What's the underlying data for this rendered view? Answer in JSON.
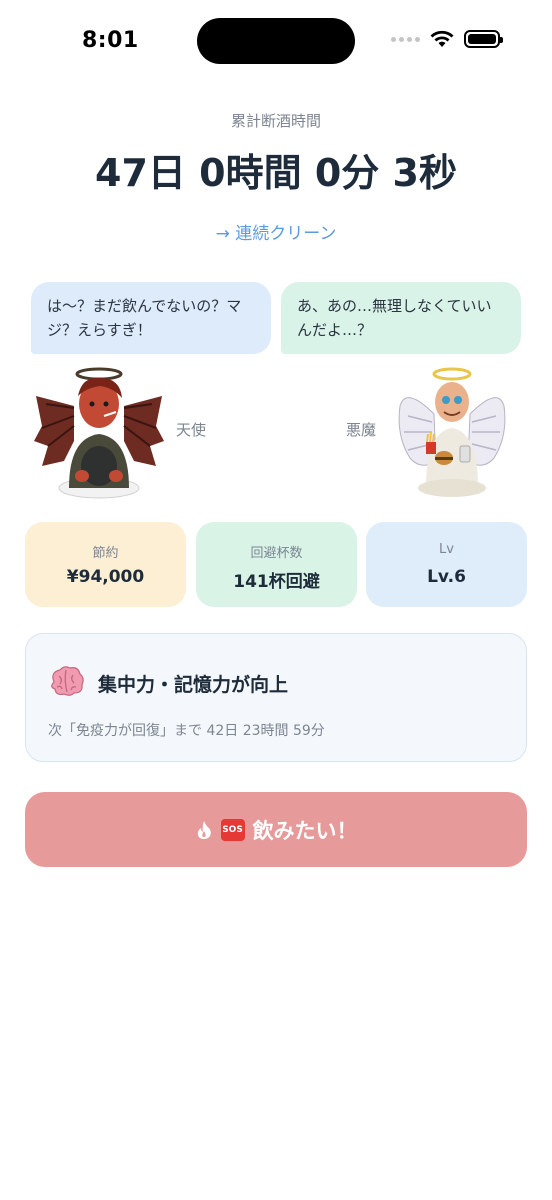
{
  "status_bar": {
    "time": "8:01"
  },
  "header": {
    "total_label": "累計断酒時間",
    "timer": "47日 0時間 0分 3秒",
    "streak_link": "→ 連続クリーン"
  },
  "bubbles": {
    "left": "は〜？まだ飲んでないの？マジ？えらすぎ！",
    "right": "あ、あの…無理しなくていいんだよ…？"
  },
  "characters": {
    "left_name": "天使",
    "right_name": "悪魔"
  },
  "stats": [
    {
      "label": "節約",
      "value": "¥94,000"
    },
    {
      "label": "回避杯数",
      "value": "141杯回避"
    },
    {
      "label": "Lv",
      "value": "Lv.6"
    }
  ],
  "benefit": {
    "icon": "brain-icon",
    "title": "集中力・記憶力が向上",
    "next": "次「免疫力が回復」まで 42日 23時間 59分"
  },
  "sos": {
    "label": "飲みたい！",
    "badge": "SOS"
  },
  "colors": {
    "accent_link": "#5b9be0",
    "sos_button": "#e69a99",
    "card_savings": "#fcefd3",
    "card_avoided": "#d9f3e7",
    "card_level": "#dfedfb"
  }
}
